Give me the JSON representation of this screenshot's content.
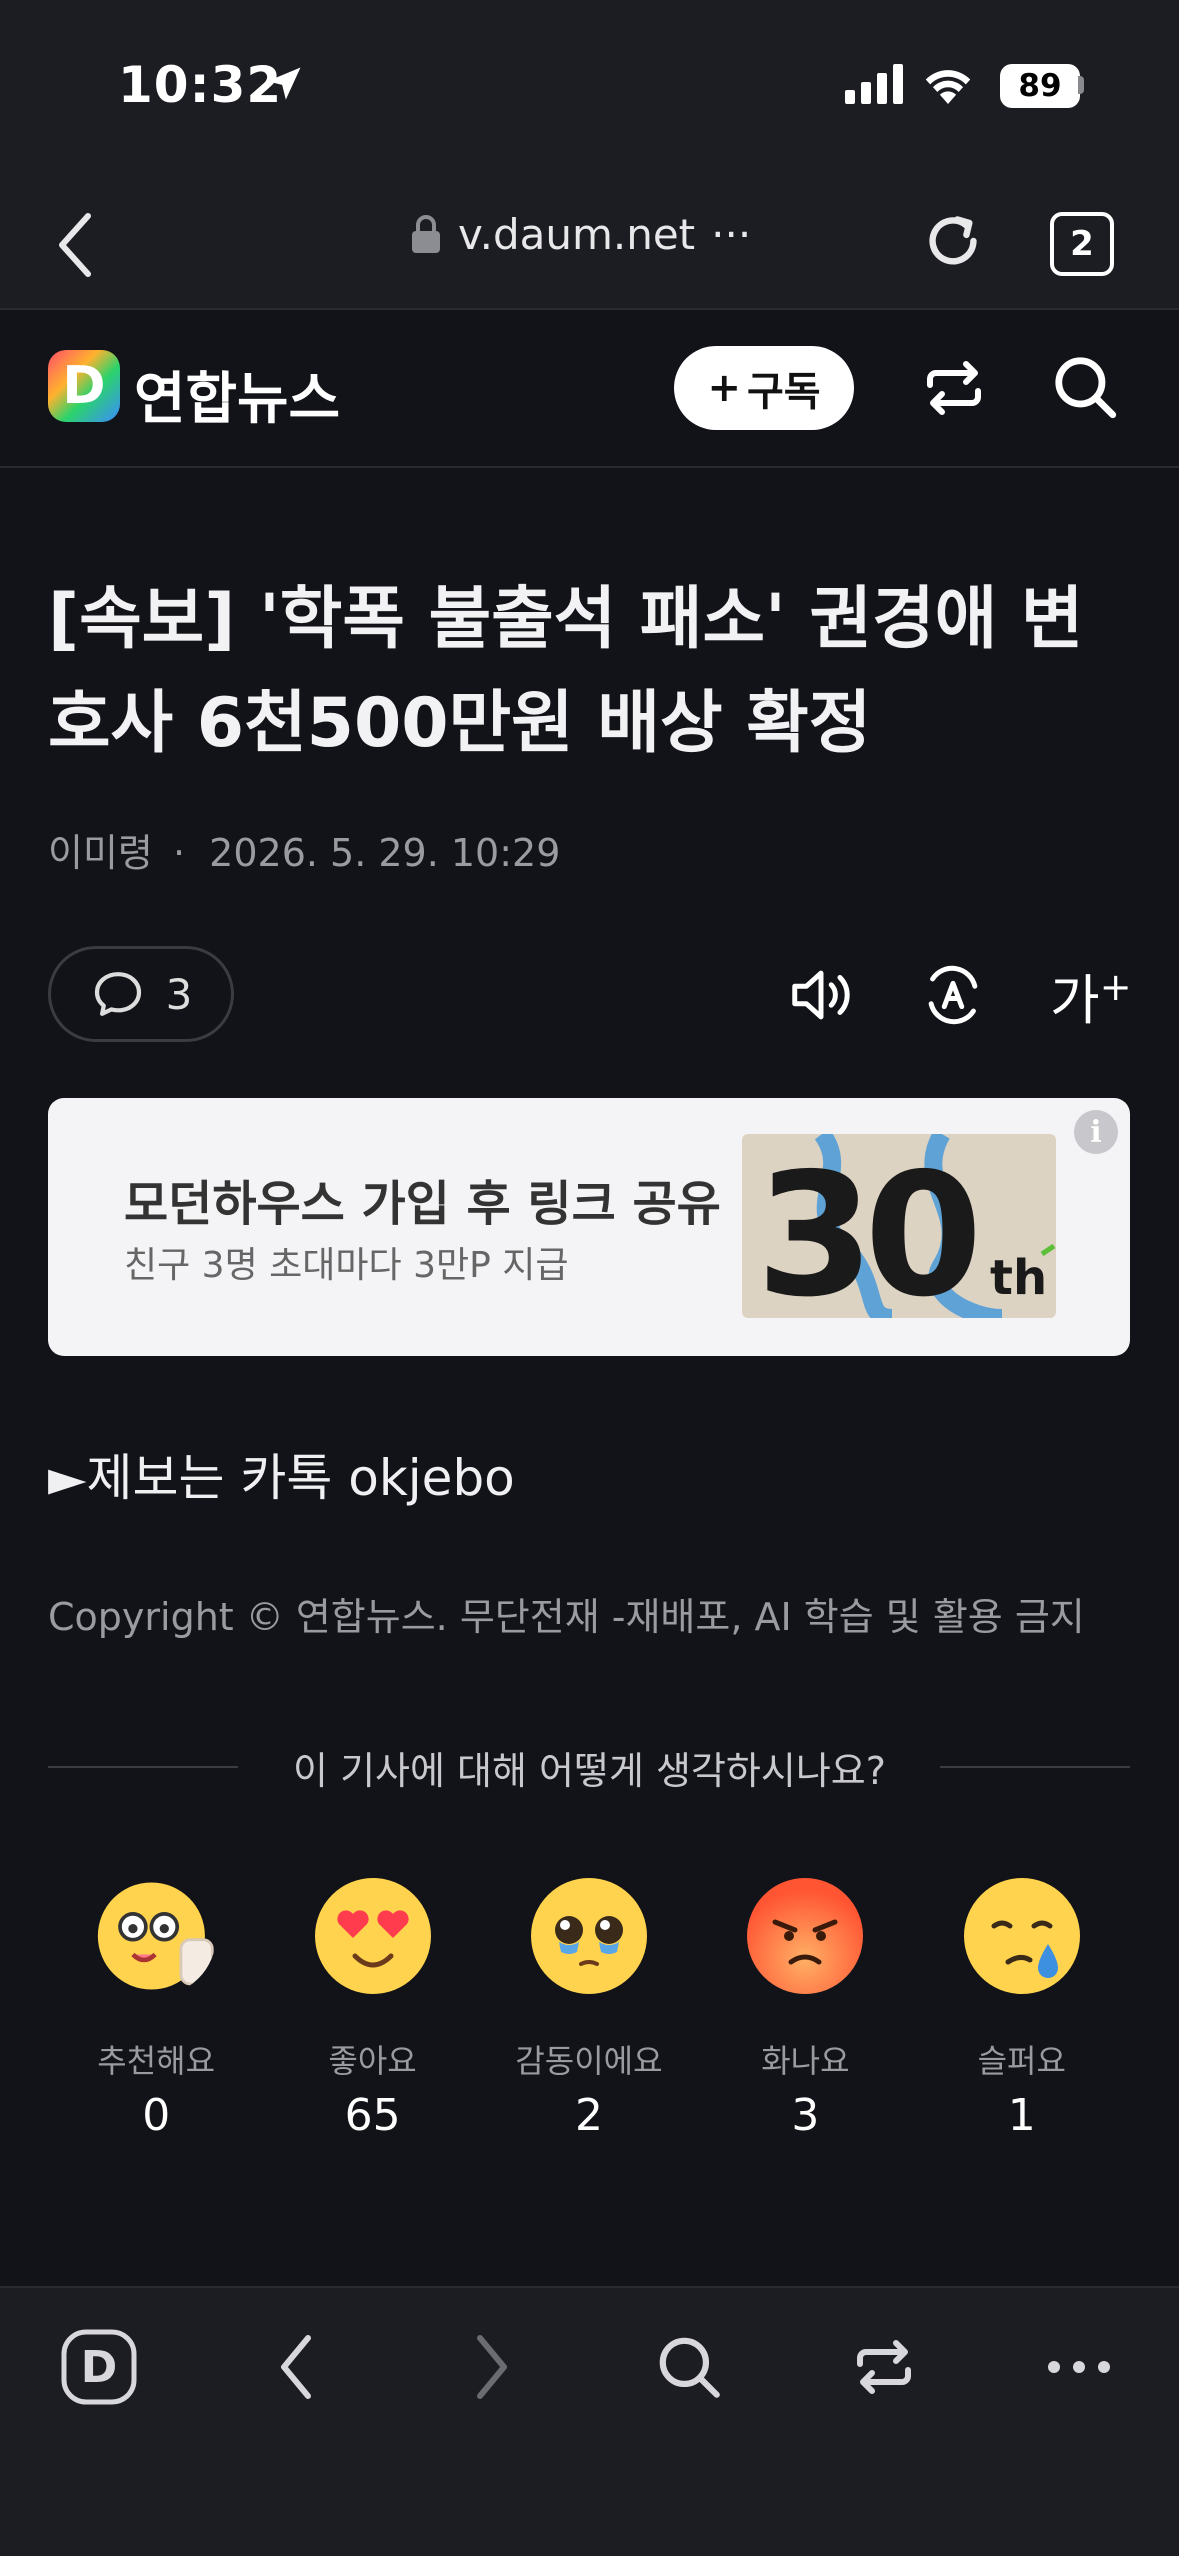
{
  "status_bar": {
    "time": "10:32",
    "battery": "89"
  },
  "browser": {
    "url": "v.daum.net",
    "url_more": "···",
    "tab_count": "2"
  },
  "site": {
    "logo_letter": "D",
    "publisher": "연합뉴스",
    "subscribe_plus": "+",
    "subscribe_label": "구독"
  },
  "article": {
    "headline": "[속보] '학폭 불출석 패소' 권경애 변호사 6천500만원 배상 확정",
    "author": "이미령",
    "separator": "·",
    "datetime": "2026. 5. 29. 10:29",
    "comment_count": "3",
    "font_size_label": "가",
    "font_size_plus": "+",
    "tip": "►제보는 카톡 okjebo",
    "copyright": "Copyright © 연합뉴스. 무단전재 -재배포, AI 학습 및 활용 금지"
  },
  "ad": {
    "title": "모던하우스 가입 후 링크 공유",
    "subtitle": "친구 3명 초대마다 3만P 지급",
    "image_text": "30",
    "image_suffix": "th",
    "info": "i"
  },
  "reactions": {
    "question": "이 기사에 대해 어떻게 생각하시나요?",
    "items": [
      {
        "label": "추천해요",
        "count": "0",
        "icon": "nerd-thumbs-up-icon"
      },
      {
        "label": "좋아요",
        "count": "65",
        "icon": "heart-eyes-icon"
      },
      {
        "label": "감동이에요",
        "count": "2",
        "icon": "teary-eyes-icon"
      },
      {
        "label": "화나요",
        "count": "3",
        "icon": "angry-face-icon"
      },
      {
        "label": "슬퍼요",
        "count": "1",
        "icon": "sad-tear-icon"
      }
    ]
  },
  "toolbar": {
    "home_letter": "D"
  }
}
